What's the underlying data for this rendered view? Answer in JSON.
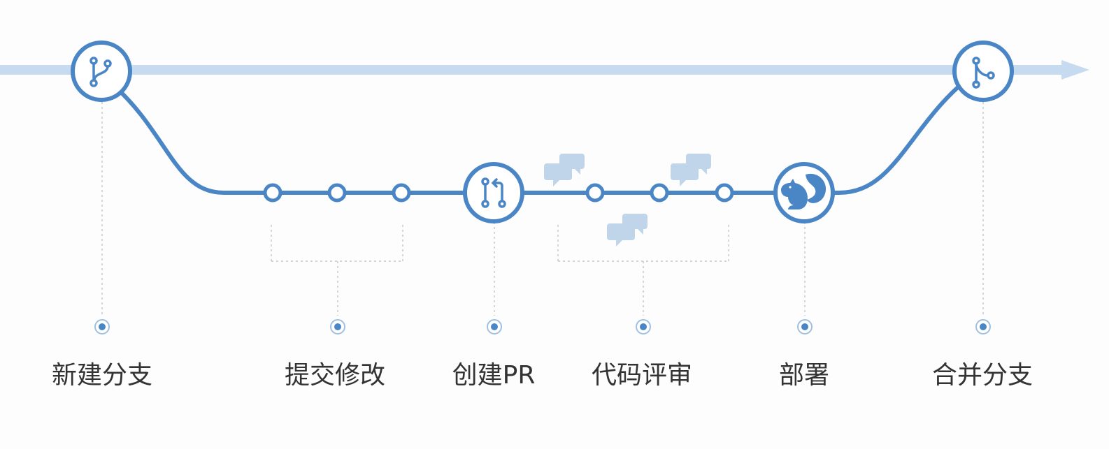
{
  "colors": {
    "mainline": "#c6dbef",
    "branch": "#4a86c6",
    "guide": "#c8c8c8",
    "comment": "#c0d4ea",
    "label": "#333333"
  },
  "nodes": [
    {
      "id": "new-branch",
      "icon": "git-branch-icon"
    },
    {
      "id": "create-pr",
      "icon": "pull-request-icon"
    },
    {
      "id": "deploy",
      "icon": "squirrel-icon"
    },
    {
      "id": "merge-branch",
      "icon": "git-merge-icon"
    }
  ],
  "steps": [
    {
      "id": "new-branch",
      "label": "新建分支"
    },
    {
      "id": "commit",
      "label": "提交修改"
    },
    {
      "id": "create-pr",
      "label": "创建PR"
    },
    {
      "id": "review",
      "label": "代码评审"
    },
    {
      "id": "deploy",
      "label": "部署"
    },
    {
      "id": "merge",
      "label": "合并分支"
    }
  ],
  "comment_icons": [
    "comment-bubbles-icon",
    "comment-bubbles-icon",
    "comment-bubbles-icon"
  ]
}
